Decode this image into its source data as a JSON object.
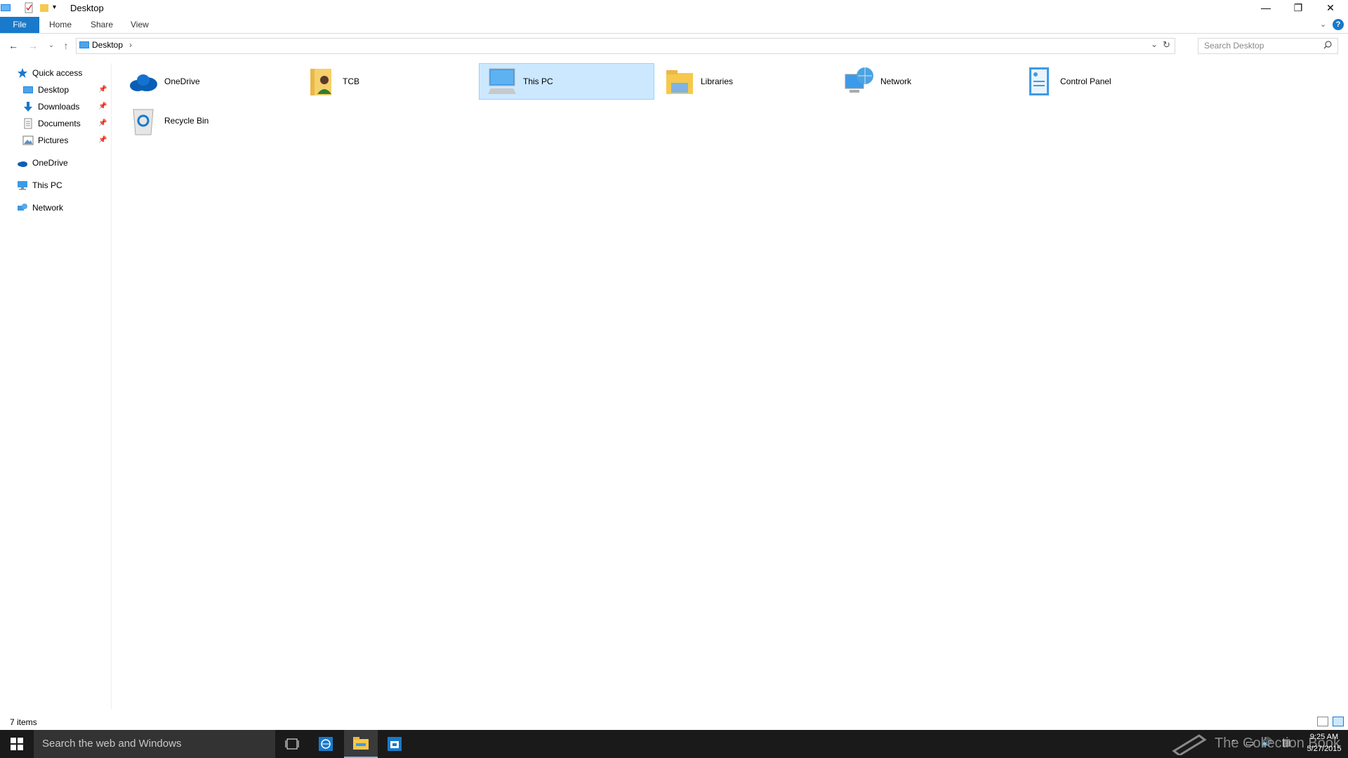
{
  "window": {
    "title": "Desktop"
  },
  "ribbon": {
    "tabs": [
      {
        "label": "File"
      },
      {
        "label": "Home"
      },
      {
        "label": "Share"
      },
      {
        "label": "View"
      }
    ]
  },
  "address": {
    "path": "Desktop",
    "search_placeholder": "Search Desktop"
  },
  "nav_pane": {
    "quick_access_label": "Quick access",
    "quick_items": [
      {
        "label": "Desktop",
        "icon": "desktop-icon"
      },
      {
        "label": "Downloads",
        "icon": "download-icon"
      },
      {
        "label": "Documents",
        "icon": "documents-icon"
      },
      {
        "label": "Pictures",
        "icon": "pictures-icon"
      }
    ],
    "onedrive_label": "OneDrive",
    "thispc_label": "This PC",
    "network_label": "Network"
  },
  "items": [
    {
      "label": "OneDrive",
      "icon": "onedrive-icon"
    },
    {
      "label": "TCB",
      "icon": "user-folder-icon"
    },
    {
      "label": "This PC",
      "icon": "this-pc-icon",
      "selected": true
    },
    {
      "label": "Libraries",
      "icon": "libraries-icon"
    },
    {
      "label": "Network",
      "icon": "network-icon"
    },
    {
      "label": "Control Panel",
      "icon": "control-panel-icon"
    },
    {
      "label": "Recycle Bin",
      "icon": "recycle-bin-icon"
    }
  ],
  "status": {
    "item_count": "7 items"
  },
  "taskbar": {
    "search_text": "Search the web and Windows",
    "watermark": "The Collection Book",
    "time": "9:25 AM",
    "date": "5/27/2015"
  },
  "colors": {
    "accent": "#1979ca",
    "selection_bg": "#cce8ff",
    "selection_border": "#99d1ff",
    "taskbar_bg": "#1a1a1a"
  }
}
